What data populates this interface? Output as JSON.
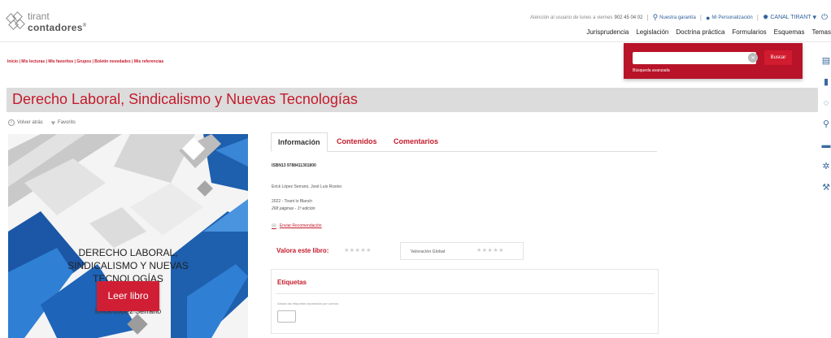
{
  "logo": {
    "line1": "tirant",
    "line2": "contadores",
    "reg": "®"
  },
  "topbar": {
    "support_text": "Atención al usuario de lunes a viernes",
    "support_phone": "902 45 04 02",
    "guarantee": "Nuestra garantía",
    "personalization": "Mi Personalización",
    "channel": "CANAL TIRANT"
  },
  "nav": [
    "Jurisprudencia",
    "Legislación",
    "Doctrina práctica",
    "Formularios",
    "Esquemas",
    "Temas"
  ],
  "breadcrumb": "Inicio | Mis lecturas | Mis favoritos | Grupos | Boletín novedades | Mis referencias",
  "search": {
    "placeholder": "",
    "button": "Buscar",
    "advanced": "Búsqueda avanzada"
  },
  "book": {
    "title": "Derecho Laboral, Sindicalismo y Nuevas Tecnologías",
    "back": "Volver atrás",
    "favorite": "Favorito",
    "cover_title_1": "DERECHO LABORAL,",
    "cover_title_2": "SINDICALISMO Y NUEVAS",
    "cover_title_3": "TECNOLOGÍAS",
    "cover_author_1": "José Luis Rosino",
    "cover_author_2": "Erick López Serrano",
    "read_button": "Leer libro",
    "isbn": "ISBN13 9788411301800",
    "authors": "Erick López Serrano, José Luis Rosino",
    "publisher": "2022 - Tirant lo Blanch",
    "pages": "268 páginas - 1ª edición",
    "recommend": "Enviar Recomendación",
    "rate_label": "Valora este libro:",
    "global_label": "Valoración Global",
    "tags_title": "Etiquetas",
    "tags_hint": "Añada las etiquetas separados por comas:"
  },
  "tabs": [
    "Información",
    "Contenidos",
    "Comentarios"
  ],
  "colors": {
    "brand_red": "#c41a2b",
    "search_red": "#b81328",
    "link_blue": "#2d5f9a"
  }
}
